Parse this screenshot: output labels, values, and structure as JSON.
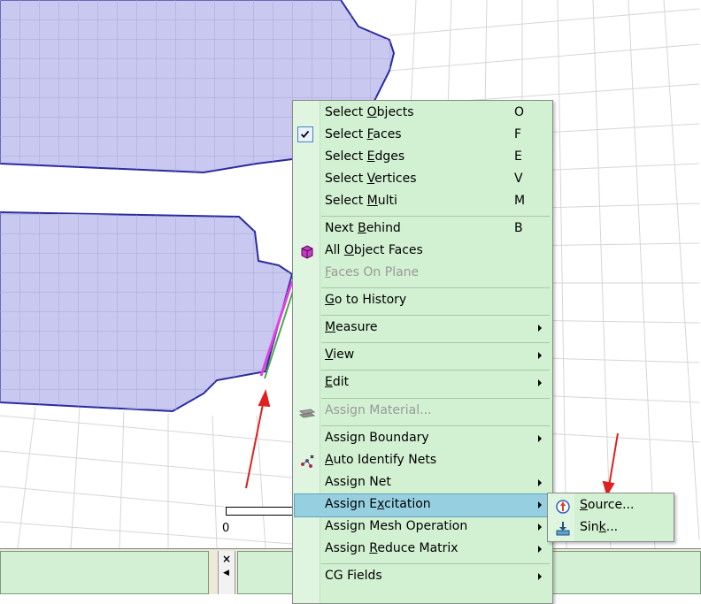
{
  "context_menu": {
    "items": [
      {
        "pre": "Select ",
        "mn": "O",
        "post": "bjects",
        "shortcut": "O"
      },
      {
        "pre": "Select ",
        "mn": "F",
        "post": "aces",
        "shortcut": "F",
        "checked": true
      },
      {
        "pre": "Select ",
        "mn": "E",
        "post": "dges",
        "shortcut": "E"
      },
      {
        "pre": "Select ",
        "mn": "V",
        "post": "ertices",
        "shortcut": "V"
      },
      {
        "pre": "Select ",
        "mn": "M",
        "post": "ulti",
        "shortcut": "M"
      },
      {
        "pre": "Next ",
        "mn": "B",
        "post": "ehind",
        "shortcut": "B"
      },
      {
        "pre": "All ",
        "mn": "O",
        "post": "bject Faces",
        "icon": "cube-icon"
      },
      {
        "pre": "",
        "mn": "F",
        "post": "aces On Plane",
        "disabled": true
      },
      {
        "pre": "",
        "mn": "G",
        "post": "o to History"
      },
      {
        "pre": "",
        "mn": "M",
        "post": "easure",
        "submenu": true
      },
      {
        "pre": "",
        "mn": "V",
        "post": "iew",
        "submenu": true
      },
      {
        "pre": "",
        "mn": "E",
        "post": "dit",
        "submenu": true
      },
      {
        "pre": "Assign Material...",
        "mn": "",
        "post": "",
        "disabled": true,
        "icon": "material-icon"
      },
      {
        "pre": "Assign Boundary",
        "mn": "",
        "post": "",
        "submenu": true
      },
      {
        "pre": "",
        "mn": "A",
        "post": "uto Identify Nets",
        "icon": "nets-icon"
      },
      {
        "pre": "Assign Net",
        "mn": "",
        "post": "",
        "submenu": true
      },
      {
        "pre": "Assign E",
        "mn": "x",
        "post": "citation",
        "submenu": true,
        "highlighted": true
      },
      {
        "pre": "Assign Mesh Operation",
        "mn": "",
        "post": "",
        "submenu": true
      },
      {
        "pre": "Assign ",
        "mn": "R",
        "post": "educe Matrix",
        "submenu": true
      },
      {
        "pre": "CG Fields",
        "mn": "",
        "post": "",
        "submenu": true
      }
    ]
  },
  "submenu": {
    "items": [
      {
        "pre": "",
        "mn": "S",
        "post": "ource...",
        "icon": "source-icon"
      },
      {
        "pre": "Sin",
        "mn": "k",
        "post": "...",
        "icon": "sink-icon"
      }
    ]
  },
  "viewport": {
    "scale_zero_label": "0"
  },
  "bottom_panel": {
    "close_glyph": "×",
    "arrow_glyph": "◀"
  },
  "colors": {
    "menu_bg": "#d2f0d2",
    "highlight": "#96d0e0",
    "plate_fill": "#c8c8f0",
    "plate_edge": "#2a2aa0",
    "annotation_arrow": "#e02020"
  }
}
